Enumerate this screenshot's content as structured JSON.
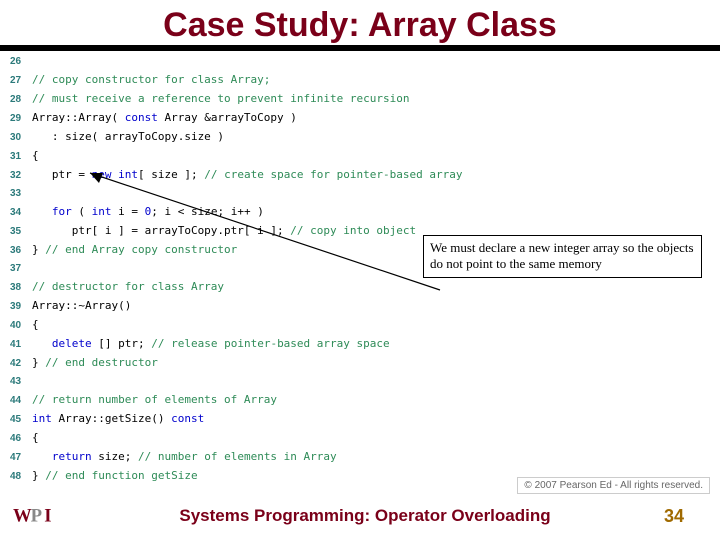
{
  "title": "Case Study: Array Class",
  "code": {
    "l26": {
      "n": "26",
      "cm": ""
    },
    "l27": {
      "n": "27",
      "cm": "// copy constructor for class Array;"
    },
    "l28": {
      "n": "28",
      "cm": "// must receive a reference to prevent infinite recursion"
    },
    "l29": {
      "n": "29",
      "a": "Array::Array( ",
      "kw": "const",
      "b": " Array &arrayToCopy )"
    },
    "l30": {
      "n": "30",
      "a": "   : size( arrayToCopy.size )"
    },
    "l31": {
      "n": "31",
      "a": "{"
    },
    "l32": {
      "n": "32",
      "a": "   ptr = ",
      "kw": "new",
      "b": " ",
      "kw2": "int",
      "c": "[ size ]; ",
      "cm": "// create space for pointer-based array"
    },
    "l33": {
      "n": "33"
    },
    "l34": {
      "n": "34",
      "a": "   ",
      "kw": "for",
      "b": " ( ",
      "kw2": "int",
      "c": " i = ",
      "kw3": "0",
      "d": "; i < size; i++ )"
    },
    "l35": {
      "n": "35",
      "a": "      ptr[ i ] = arrayToCopy.ptr[ i ]; ",
      "cm": "// copy into object"
    },
    "l36": {
      "n": "36",
      "a": "} ",
      "cm": "// end Array copy constructor"
    },
    "l37": {
      "n": "37"
    },
    "l38": {
      "n": "38",
      "cm": "// destructor for class Array"
    },
    "l39": {
      "n": "39",
      "a": "Array::~Array()"
    },
    "l40": {
      "n": "40",
      "a": "{"
    },
    "l41": {
      "n": "41",
      "a": "   ",
      "kw": "delete",
      "b": " [] ptr; ",
      "cm": "// release pointer-based array space"
    },
    "l42": {
      "n": "42",
      "a": "} ",
      "cm": "// end destructor"
    },
    "l43": {
      "n": "43"
    },
    "l44": {
      "n": "44",
      "cm": "// return number of elements of Array"
    },
    "l45": {
      "n": "45",
      "kw0": "int",
      "a": " Array::getSize() ",
      "kw": "const"
    },
    "l46": {
      "n": "46",
      "a": "{"
    },
    "l47": {
      "n": "47",
      "a": "   ",
      "kw": "return",
      "b": " size; ",
      "cm": "// number of elements in Array"
    },
    "l48": {
      "n": "48",
      "a": "} ",
      "cm": "// end function getSize"
    }
  },
  "callout": "We must declare a new integer array so the objects do not point to the same memory",
  "copyright": "© 2007 Pearson Ed - All rights reserved.",
  "footer": "Systems Programming:   Operator Overloading",
  "page": "34"
}
